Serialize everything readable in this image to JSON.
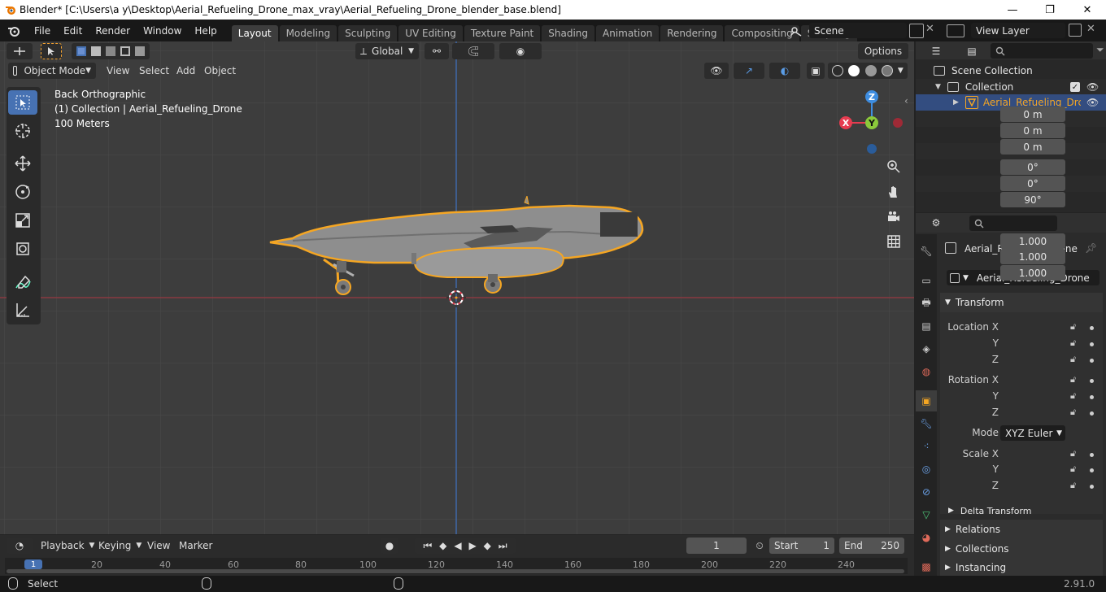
{
  "window": {
    "title": "Blender* [C:\\Users\\a y\\Desktop\\Aerial_Refueling_Drone_max_vray\\Aerial_Refueling_Drone_blender_base.blend]",
    "minimize": "—",
    "maximize": "❐",
    "close": "✕"
  },
  "menu": {
    "items": [
      "File",
      "Edit",
      "Render",
      "Window",
      "Help"
    ],
    "workspaces": [
      "Layout",
      "Modeling",
      "Sculpting",
      "UV Editing",
      "Texture Paint",
      "Shading",
      "Animation",
      "Rendering",
      "Compositing",
      "Scripting"
    ],
    "active_workspace": "Layout",
    "add_workspace": "+",
    "scene": "Scene",
    "view_layer": "View Layer"
  },
  "viewport": {
    "transform_orientation": "Global",
    "options": "Options",
    "mode": "Object Mode",
    "header_menus": [
      "View",
      "Select",
      "Add",
      "Object"
    ],
    "info_view": "Back Orthographic",
    "info_collection": "(1) Collection | Aerial_Refueling_Drone",
    "info_scale": "100 Meters",
    "gizmo": {
      "z": "Z",
      "x": "X",
      "y": "Y"
    }
  },
  "outliner": {
    "scene_collection": "Scene Collection",
    "collection": "Collection",
    "object": "Aerial_Refueling_Drc"
  },
  "properties": {
    "object_name": "Aerial_Refueling_Drone",
    "object_datablock": "Aerial_Refueling_Drone",
    "transform_header": "Transform",
    "location_label": "Location X",
    "location": [
      "0 m",
      "0 m",
      "0 m"
    ],
    "rotation_label": "Rotation X",
    "rotation": [
      "0°",
      "0°",
      "90°"
    ],
    "axis_y": "Y",
    "axis_z": "Z",
    "mode_label": "Mode",
    "mode_value": "XYZ Euler",
    "scale_label": "Scale X",
    "scale": [
      "1.000",
      "1.000",
      "1.000"
    ],
    "delta_transform": "Delta Transform",
    "relations": "Relations",
    "collections": "Collections",
    "instancing": "Instancing"
  },
  "timeline": {
    "menus": [
      "Playback",
      "Keying",
      "View",
      "Marker"
    ],
    "current_frame": "1",
    "start_label": "Start",
    "start": "1",
    "end_label": "End",
    "end": "250",
    "ruler": [
      "1",
      "20",
      "40",
      "60",
      "80",
      "100",
      "120",
      "140",
      "160",
      "180",
      "200",
      "220",
      "240"
    ]
  },
  "statusbar": {
    "left": "Select",
    "version": "2.91.0"
  },
  "colors": {
    "selection_outline": "#f5a623",
    "active_blue": "#4772b3",
    "x_axis": "#e63c50",
    "y_axis": "#8bc93b",
    "z_axis": "#3e8de0"
  }
}
